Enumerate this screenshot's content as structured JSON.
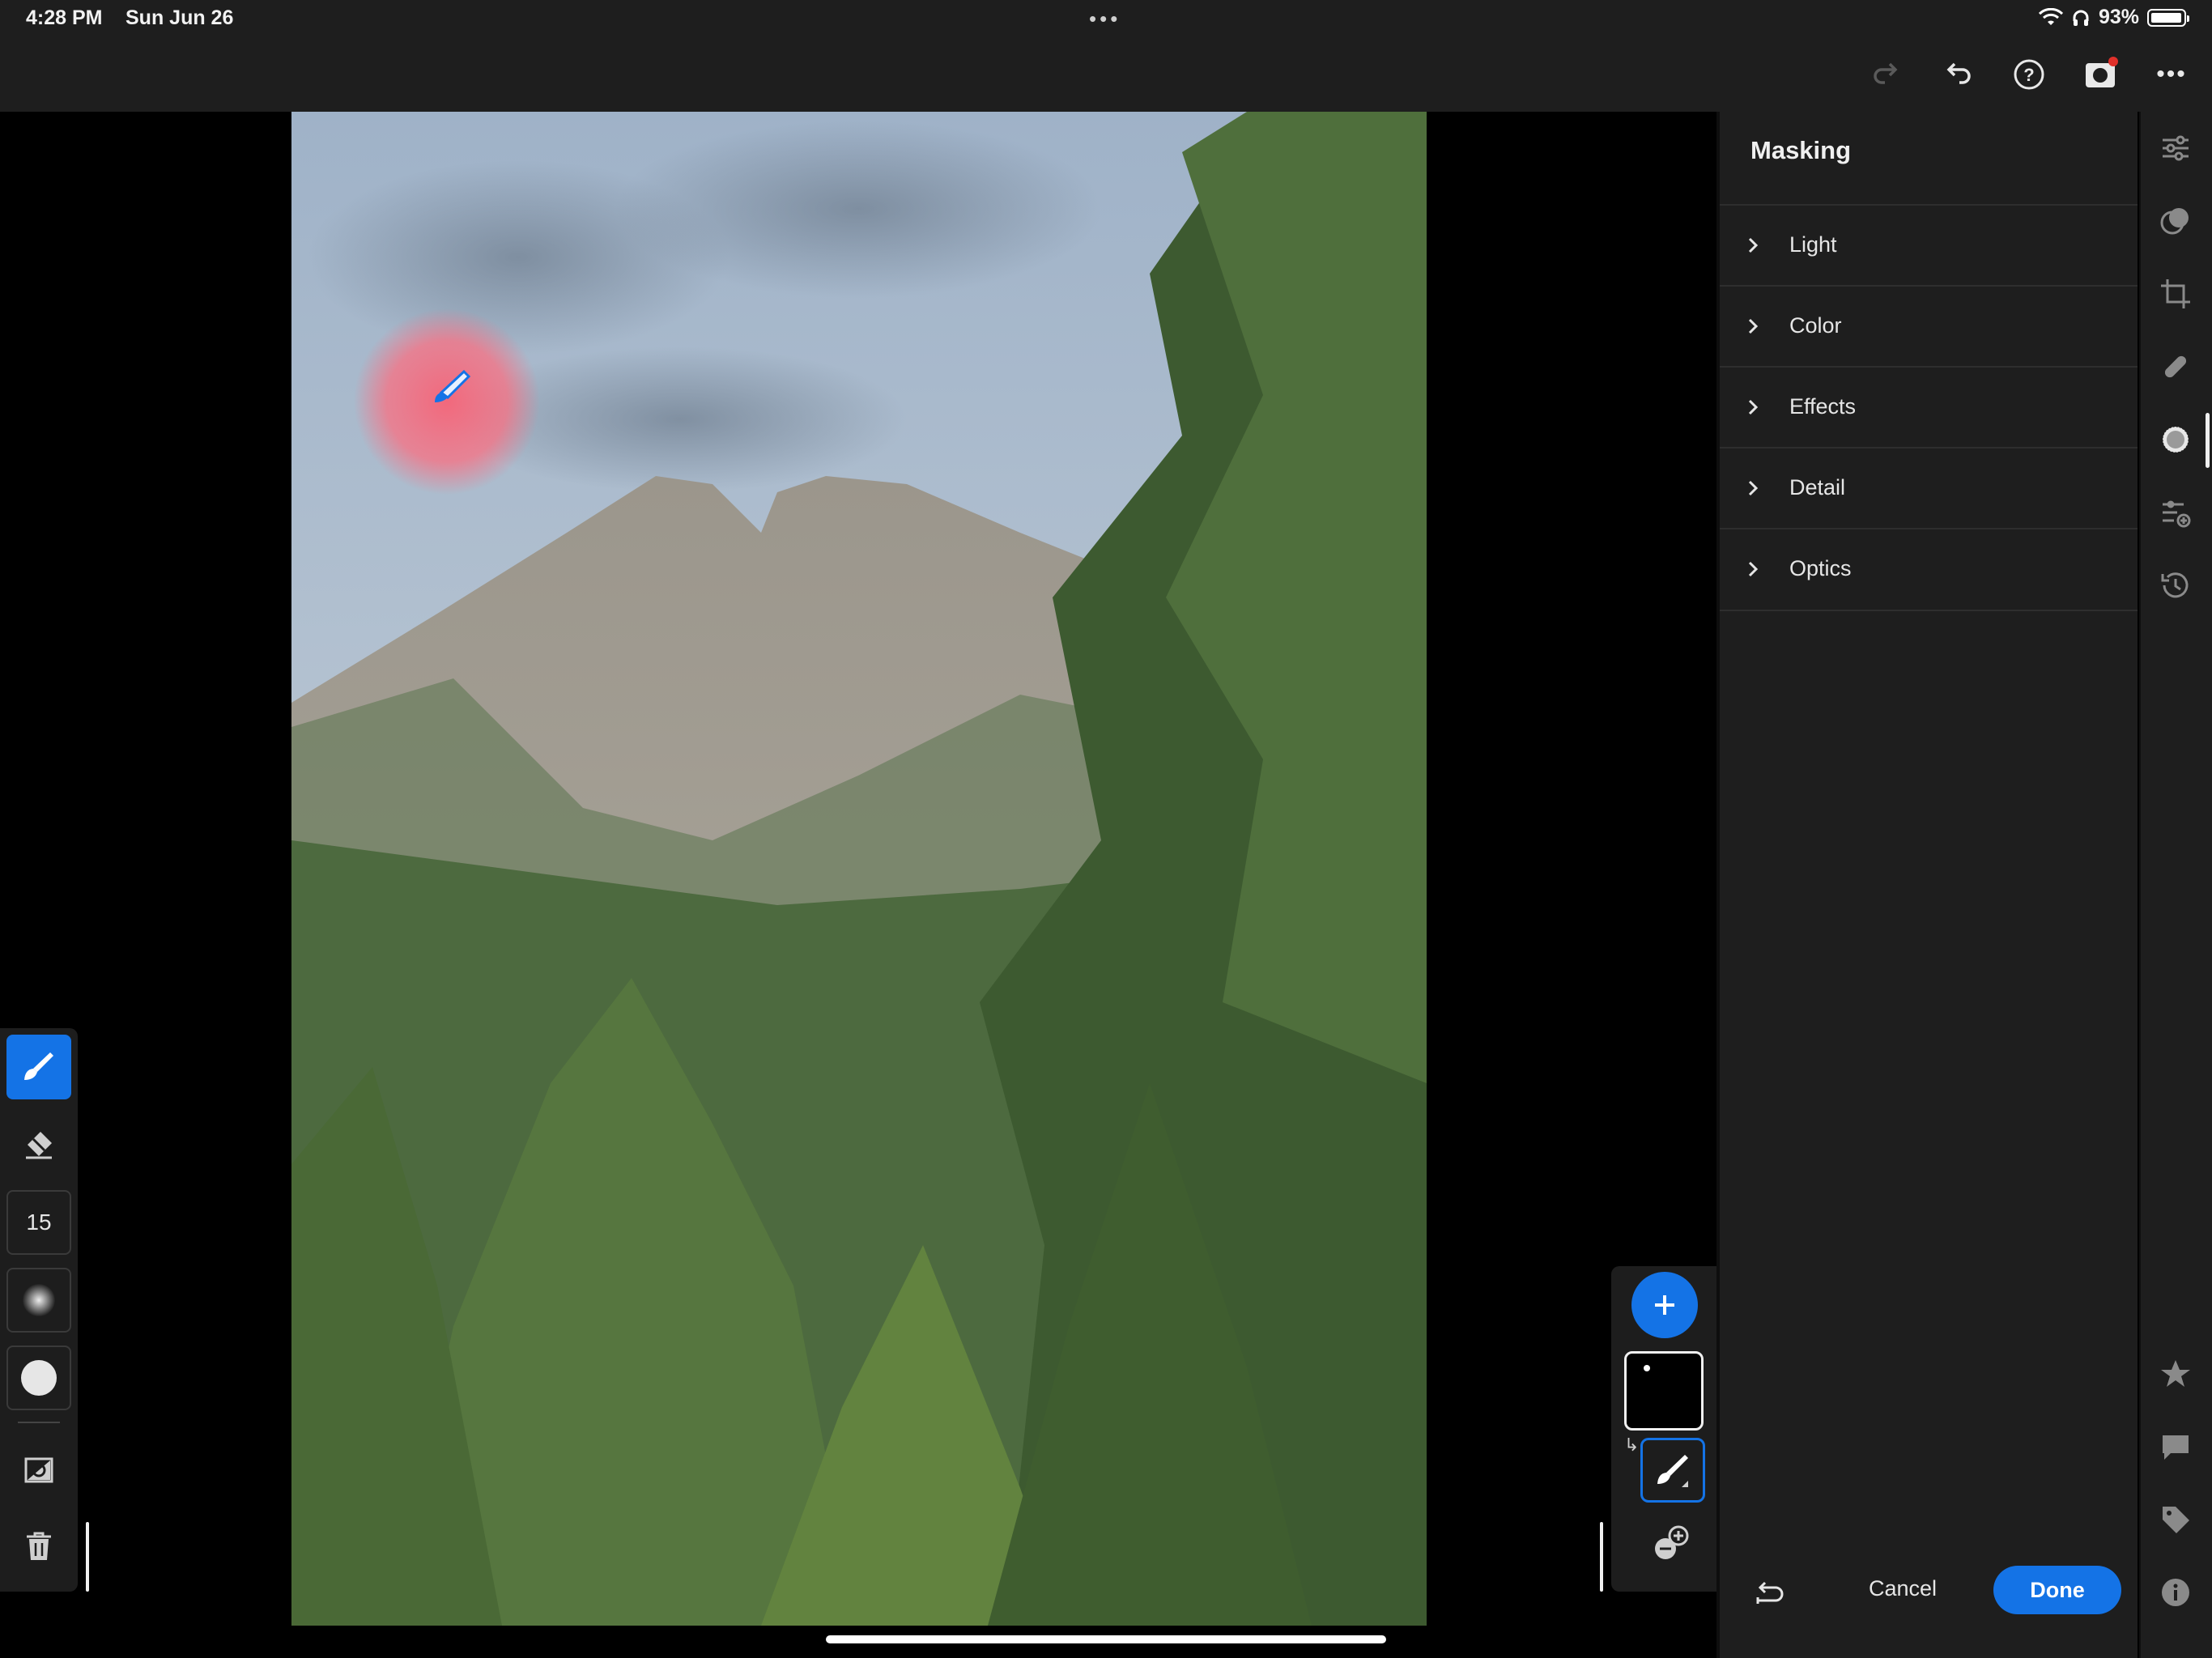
{
  "status_bar": {
    "time": "4:28 PM",
    "date": "Sun Jun 26",
    "battery": "93%",
    "multitask_dots": "•••"
  },
  "toolbar": {
    "icons": [
      "redo-icon",
      "undo-icon",
      "help-icon",
      "share-icon",
      "more-icon"
    ],
    "more": "•••"
  },
  "panel": {
    "title": "Masking",
    "sections": [
      {
        "label": "Light"
      },
      {
        "label": "Color"
      },
      {
        "label": "Effects"
      },
      {
        "label": "Detail"
      },
      {
        "label": "Optics"
      }
    ],
    "cancel_label": "Cancel",
    "done_label": "Done"
  },
  "rail": {
    "icons": [
      "edit-sliders-icon",
      "presets-icon",
      "crop-icon",
      "healing-icon",
      "masking-icon",
      "versions-icon",
      "history-icon",
      "star-icon",
      "comment-icon",
      "tag-icon",
      "info-icon"
    ],
    "active": "masking-icon"
  },
  "brush_tools": {
    "size_value": "15",
    "tools": [
      "brush-icon",
      "eraser-icon",
      "size",
      "feather-icon",
      "flow-icon",
      "invert-icon",
      "trash-icon"
    ]
  },
  "colors": {
    "accent": "#1473e6",
    "panel_bg": "#1e1e1e",
    "mask_overlay": "#ff5a6e"
  }
}
